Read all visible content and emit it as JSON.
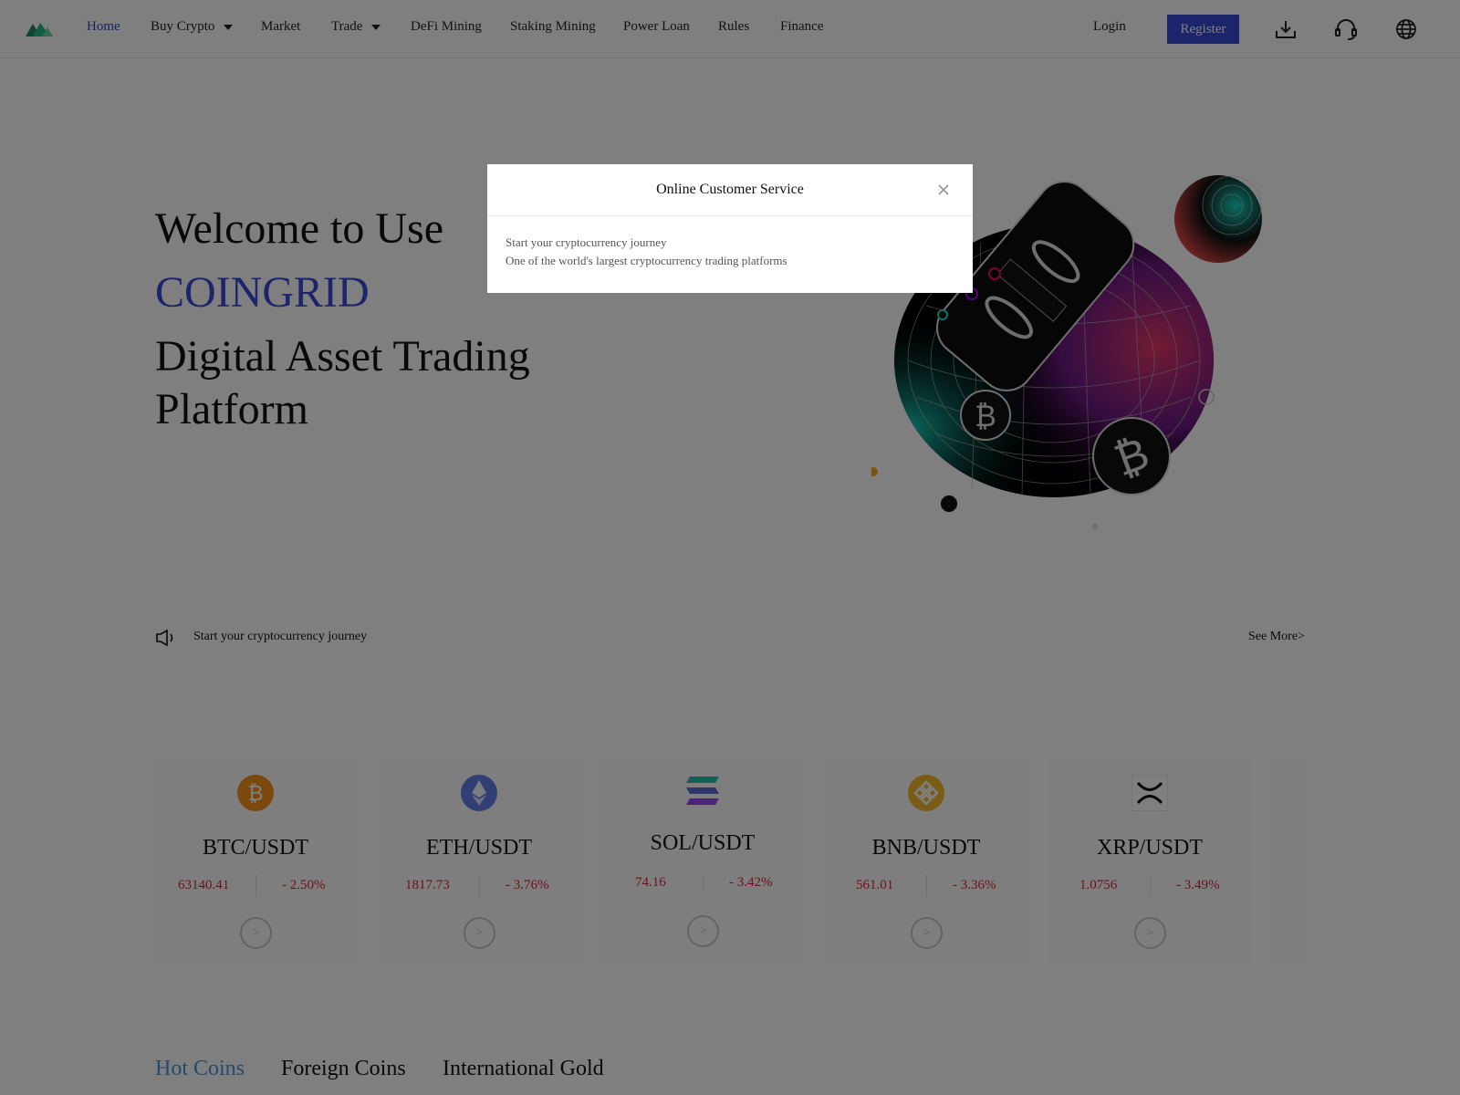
{
  "nav": {
    "items": [
      {
        "label": "Home",
        "active": true
      },
      {
        "label": "Buy Crypto",
        "dropdown": true
      },
      {
        "label": "Market"
      },
      {
        "label": "Trade",
        "dropdown": true
      },
      {
        "label": "DeFi Mining"
      },
      {
        "label": "Staking Mining"
      },
      {
        "label": "Power Loan"
      },
      {
        "label": "Rules"
      },
      {
        "label": "Finance"
      }
    ],
    "login_label": "Login",
    "register_label": "Register",
    "icons": [
      "download-icon",
      "headset-icon",
      "globe-icon"
    ],
    "accent_color": "#3848d8"
  },
  "hero": {
    "line1": "Welcome to Use",
    "brand": "COINGRID",
    "line3": "Digital Asset Trading",
    "line4": "Platform"
  },
  "notice": {
    "text": "Start your cryptocurrency journey",
    "see_more": "See More>"
  },
  "cards": [
    {
      "pair": "BTC/USDT",
      "price": "63140.41",
      "change": "- 2.50%",
      "icon": "bitcoin-icon",
      "color": "#f7931a"
    },
    {
      "pair": "ETH/USDT",
      "price": "1817.73",
      "change": "- 3.76%",
      "icon": "ethereum-icon",
      "color": "#627eea"
    },
    {
      "pair": "SOL/USDT",
      "price": "74.16",
      "change": "- 3.42%",
      "icon": "solana-icon",
      "color": "#14f195"
    },
    {
      "pair": "BNB/USDT",
      "price": "561.01",
      "change": "- 3.36%",
      "icon": "bnb-icon",
      "color": "#f3ba2f"
    },
    {
      "pair": "XRP/USDT",
      "price": "1.0756",
      "change": "- 3.49%",
      "icon": "xrp-icon",
      "color": "#23292f"
    }
  ],
  "card_go_label": ">",
  "tabs": [
    {
      "label": "Hot Coins",
      "active": true
    },
    {
      "label": "Foreign Coins"
    },
    {
      "label": "International Gold"
    }
  ],
  "modal": {
    "title": "Online Customer Service",
    "line1": "Start your cryptocurrency journey",
    "line2": "One of the world's largest cryptocurrency trading platforms"
  },
  "colors": {
    "down": "#d81e3a",
    "active_tab": "#4b93d8"
  }
}
